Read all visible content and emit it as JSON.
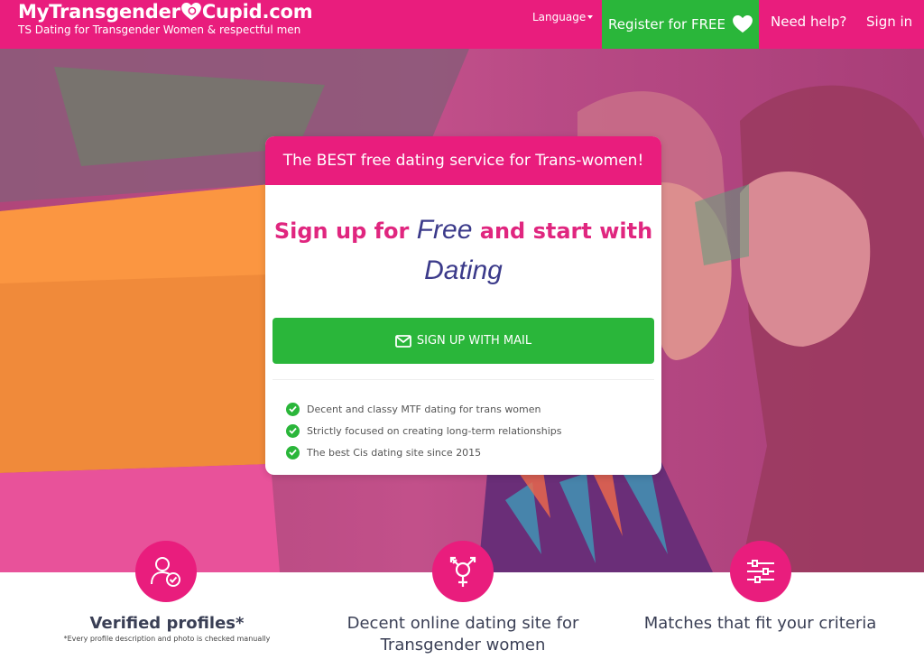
{
  "header": {
    "logo_part1": "MyTransgender",
    "logo_part2": "Cupid.com",
    "tagline": "TS Dating for Transgender Women & respectful men",
    "language_label": "Language",
    "register_label": "Register for FREE",
    "help_label": "Need help?",
    "signin_label": "Sign in"
  },
  "card": {
    "heading": "The BEST free dating service for Trans-women!",
    "title_part1": "Sign up for ",
    "title_free": "Free",
    "title_part2": " and start with",
    "title_dating": "Dating",
    "signup_button": "SIGN UP WITH MAIL",
    "features": [
      "Decent and classy MTF dating for trans women",
      "Strictly focused on creating long-term relationships",
      "The best Cis dating site since 2015"
    ]
  },
  "bottom": {
    "feature1_title": "Verified profiles*",
    "feature1_note": "*Every profile description and photo is checked manually",
    "feature2_title_line1": "Decent online dating site for",
    "feature2_title_line2": "Transgender women",
    "feature3_title": "Matches that fit your criteria"
  },
  "colors": {
    "brand_pink": "#e91d7d",
    "cta_green": "#2ab63a",
    "title_navy": "#3b3a8a"
  },
  "icons": [
    "heart-icon",
    "caret-down-icon",
    "mail-icon",
    "check-icon",
    "verified-user-icon",
    "transgender-symbol-icon",
    "sliders-icon"
  ]
}
